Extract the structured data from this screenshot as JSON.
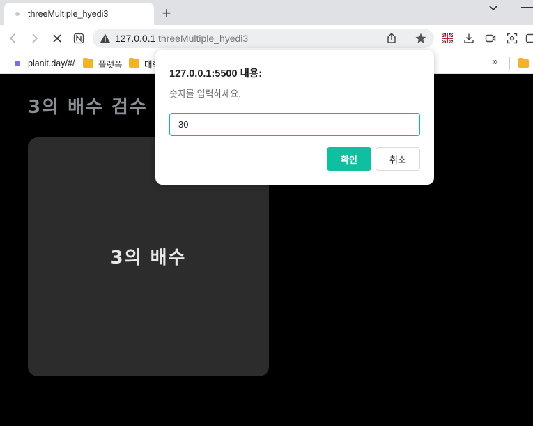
{
  "browser": {
    "tab_title": "threeMultiple_hyedi3",
    "new_tab_label": "+",
    "url_host": "127.0.0.1",
    "url_path": "threeMultiple_hyedi3",
    "bookmarks": [
      "planit.day/#/",
      "플랫폼",
      "대학"
    ],
    "bookmarks_overflow": "»"
  },
  "page": {
    "heading": "3의 배수 검수 프",
    "card_label": "3의 배수"
  },
  "dialog": {
    "title": "127.0.0.1:5500 내용:",
    "message": "숫자를 입력하세요.",
    "input_value": "30",
    "ok_label": "확인",
    "cancel_label": "취소"
  },
  "colors": {
    "accent": "#0fbfa0",
    "card_bg": "#2c2c2c",
    "page_bg": "#000000"
  }
}
